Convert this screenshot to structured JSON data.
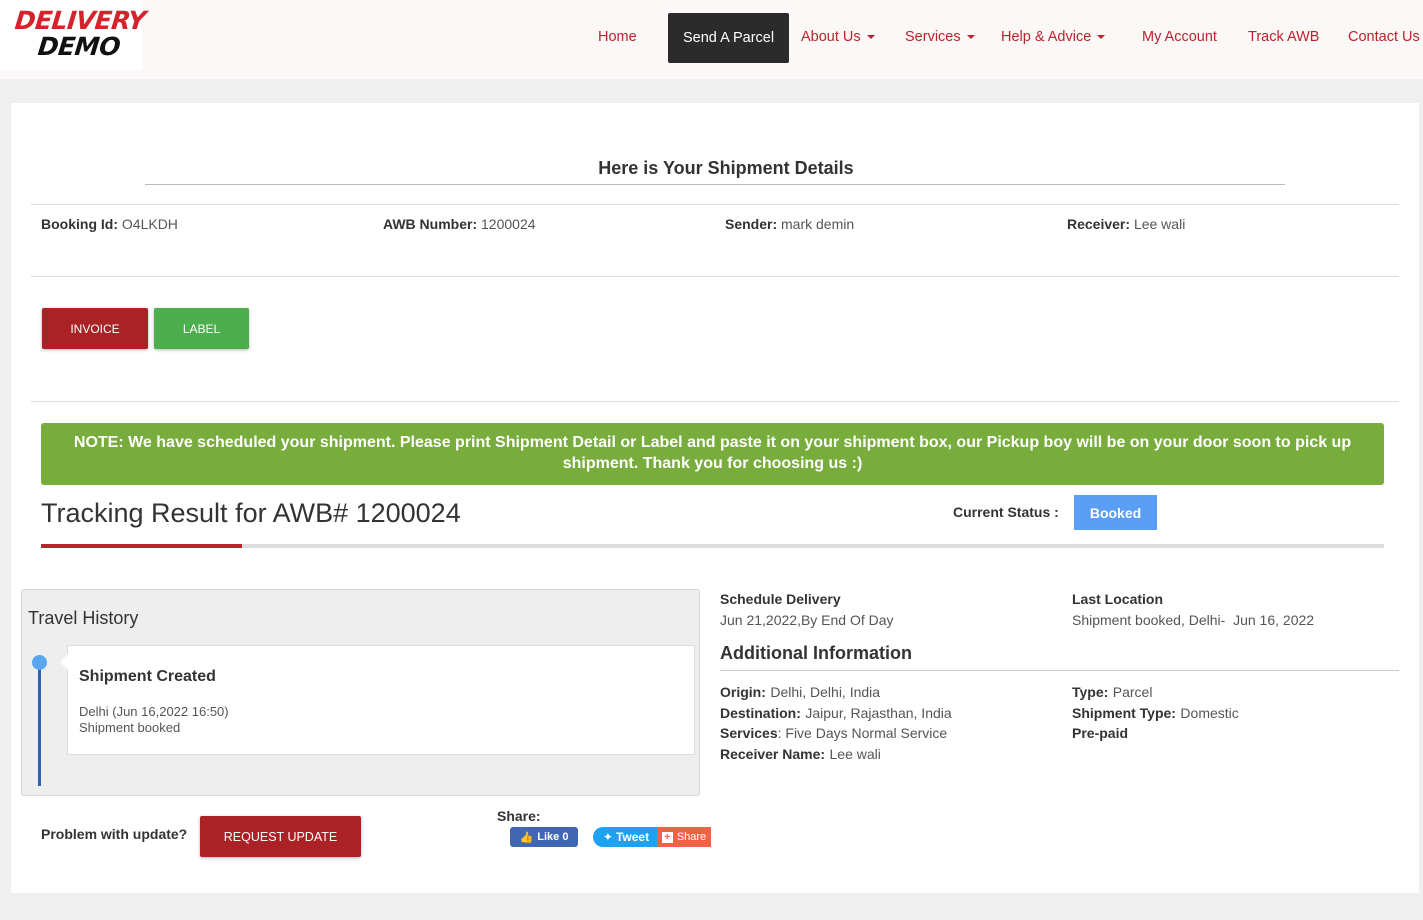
{
  "logo": {
    "line1": "DELIVERY",
    "line2": "DEMO"
  },
  "nav": {
    "home": "Home",
    "send_parcel": "Send A Parcel",
    "about": "About Us",
    "services": "Services",
    "help": "Help & Advice",
    "account": "My Account",
    "track": "Track AWB",
    "contact": "Contact Us"
  },
  "page_title": "Here is Your Shipment Details",
  "summary": {
    "booking_label": "Booking Id:",
    "booking_value": "O4LKDH",
    "awb_label": "AWB Number:",
    "awb_value": "1200024",
    "sender_label": "Sender:",
    "sender_value": "mark demin",
    "receiver_label": "Receiver:",
    "receiver_value": "Lee wali"
  },
  "buttons": {
    "invoice": "INVOICE",
    "label": "LABEL",
    "request_update": "REQUEST UPDATE"
  },
  "note": "NOTE: We have scheduled your shipment. Please print Shipment Detail or Label and paste it on your shipment box, our Pickup boy will be on your door soon to pick up shipment. Thank you for choosing us :)",
  "tracking": {
    "title": "Tracking Result for AWB# 1200024",
    "status_label": "Current Status :",
    "status": "Booked"
  },
  "history": {
    "title": "Travel History",
    "events": [
      {
        "event": "Shipment Created",
        "line1": "Delhi (Jun 16,2022 16:50)",
        "line2": "Shipment booked"
      }
    ]
  },
  "delivery": {
    "schedule_label": "Schedule Delivery",
    "schedule_value": "Jun 21,2022,By End Of Day",
    "location_label": "Last Location",
    "location_value": "Shipment booked, Delhi-  Jun 16, 2022"
  },
  "additional": {
    "title": "Additional Information",
    "origin_label": "Origin:",
    "origin_value": "Delhi, Delhi, India",
    "destination_label": "Destination:",
    "destination_value": "Jaipur, Rajasthan, India",
    "services_label": "Services",
    "services_value": ": Five Days Normal Service",
    "receiver_label": "Receiver Name:",
    "receiver_value": "Lee wali",
    "type_label": "Type:",
    "type_value": "Parcel",
    "shipment_type_label": "Shipment Type:",
    "shipment_type_value": "Domestic",
    "payment": "Pre-paid"
  },
  "problem_label": "Problem with update?",
  "share": {
    "label": "Share:",
    "like": "Like 0",
    "tweet": "Tweet",
    "share": "Share"
  },
  "colors": {
    "brand_red": "#aa2126",
    "green": "#4cae4c",
    "note_green": "#78ad3d",
    "status_blue": "#5b9ef5"
  }
}
